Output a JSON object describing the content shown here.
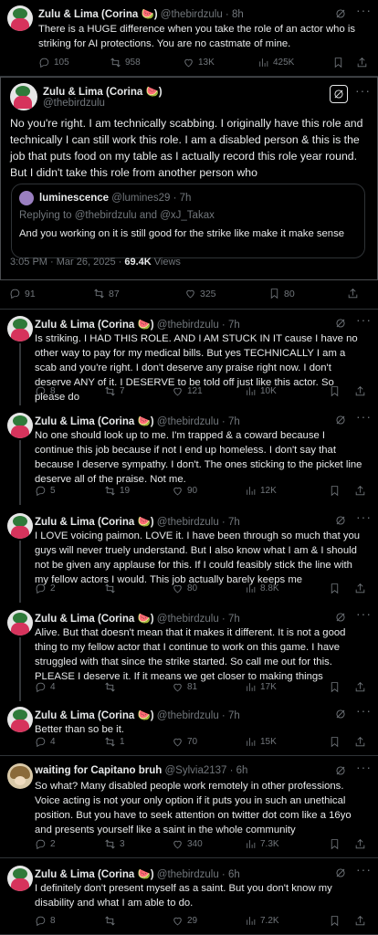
{
  "top_post": {
    "name": "Zulu & Lima (Corina 🍉)",
    "handle_time": "@thebirdzulu · 8h",
    "text": "There is a HUGE difference when you take the role of an actor who is striking for AI protections. You are no castmate of mine.",
    "replies": "105",
    "reposts": "958",
    "likes": "13K",
    "views": "425K"
  },
  "focus_post": {
    "name": "Zulu & Lima (Corina 🍉)",
    "handle": "@thebirdzulu",
    "text": "No you're right. I am technically scabbing. I originally have this role and technically I can still work this role. I am a disabled person & this is the job that puts food on my table as I actually record this role year round. But I didn't take this role from another person who",
    "quote": {
      "name": "luminescence",
      "handle_time": "@lumines29 · 7h",
      "replying": "Replying to @thebirdzulu and @xJ_Takax",
      "text": "And you working on it is still good for the strike like make it make sense"
    },
    "time": "3:05 PM · Mar 26, 2025 · ",
    "views_count": "69.4K",
    "views_label": " Views",
    "replies": "91",
    "reposts": "87",
    "likes": "325",
    "bookmarks": "80"
  },
  "replies": [
    {
      "name": "Zulu & Lima (Corina 🍉)",
      "handle_time": "@thebirdzulu · 7h",
      "avatar": "zulu",
      "text": "Is striking. I HAD THIS ROLE. AND I AM STUCK IN IT cause I have no other way to pay for my medical bills. But yes TECHNICALLY I am a scab and you're right. I don't deserve any praise right now. I don't deserve ANY of it. I DESERVE to be told off just like this actor. So please do",
      "replies": "8",
      "reposts": "7",
      "likes": "121",
      "views": "10K"
    },
    {
      "name": "Zulu & Lima (Corina 🍉)",
      "handle_time": "@thebirdzulu · 7h",
      "avatar": "zulu",
      "text": "No one should look up to me. I'm trapped & a coward because I continue this job because if not I end up homeless. I don't say that because I deserve sympathy. I don't. The ones sticking to the picket line deserve all of the praise. Not me.",
      "replies": "5",
      "reposts": "19",
      "likes": "90",
      "views": "12K"
    },
    {
      "name": "Zulu & Lima (Corina 🍉)",
      "handle_time": "@thebirdzulu · 7h",
      "avatar": "zulu",
      "text": "I LOVE voicing paimon. LOVE it. I have been through so much that you guys will never truely understand. But I also know what I am & I should not be given any applause for this. If I could feasibly stick the line with my fellow actors I would. This job actually barely keeps me",
      "replies": "2",
      "reposts": "",
      "likes": "80",
      "views": "8.8K"
    },
    {
      "name": "Zulu & Lima (Corina 🍉)",
      "handle_time": "@thebirdzulu · 7h",
      "avatar": "zulu",
      "text": "Alive. But that doesn't mean that it makes it different. It is not a good thing to my fellow actor that I continue to work on this game. I have struggled with that since the strike started. So call me out for this. PLEASE I deserve it. If it means we get closer to making things",
      "replies": "4",
      "reposts": "",
      "likes": "81",
      "views": "17K"
    },
    {
      "name": "Zulu & Lima (Corina 🍉)",
      "handle_time": "@thebirdzulu · 7h",
      "avatar": "zulu",
      "text": "Better than so be it.",
      "replies": "4",
      "reposts": "1",
      "likes": "70",
      "views": "15K"
    },
    {
      "name": "waiting for Capitano bruh",
      "handle_time": "@Sylvia2137 · 6h",
      "avatar": "waiting",
      "text": "So what? Many disabled people work remotely in other professions. Voice acting is not your only option if it puts you in such an unethical position. But you have to seek attention on twitter dot com like a 16yo and presents yourself like a saint in the whole community",
      "replies": "2",
      "reposts": "3",
      "likes": "340",
      "views": "7.3K"
    },
    {
      "name": "Zulu & Lima (Corina 🍉)",
      "handle_time": "@thebirdzulu · 6h",
      "avatar": "zulu",
      "text": "I definitely don't present myself as a saint. But you don't know my disability and what I am able to do.",
      "replies": "8",
      "reposts": "",
      "likes": "29",
      "views": "7.2K"
    }
  ]
}
